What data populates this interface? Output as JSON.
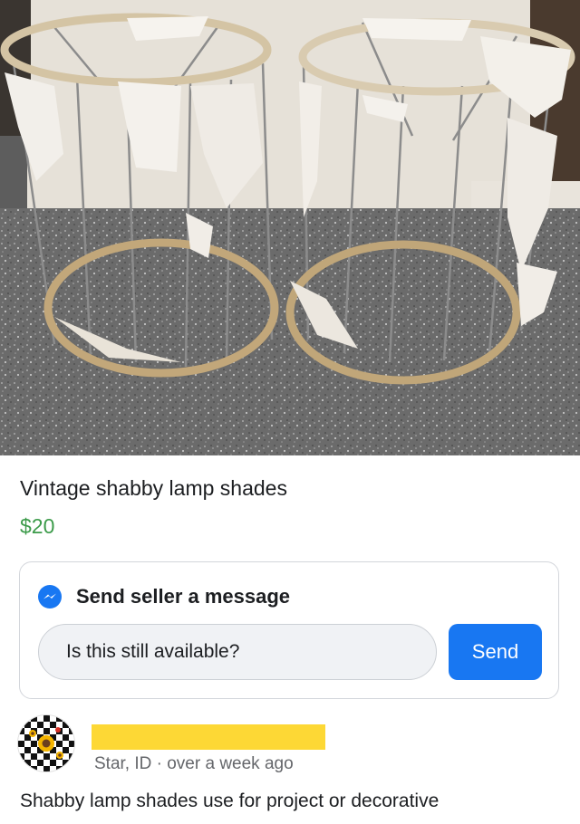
{
  "listing": {
    "title": "Vintage shabby lamp shades",
    "price": "$20",
    "price_color": "#3c9b4a"
  },
  "message_box": {
    "heading": "Send seller a message",
    "icon": "messenger-icon",
    "input_value": "Is this still available?",
    "send_label": "Send",
    "accent_color": "#1877f2"
  },
  "seller": {
    "avatar_icon": "checkered-sunflower-avatar",
    "name_redaction_color": "#fdd835",
    "location_meta": "Star, ID · over a week ago"
  },
  "description": "Shabby lamp shades use for project or decorative"
}
